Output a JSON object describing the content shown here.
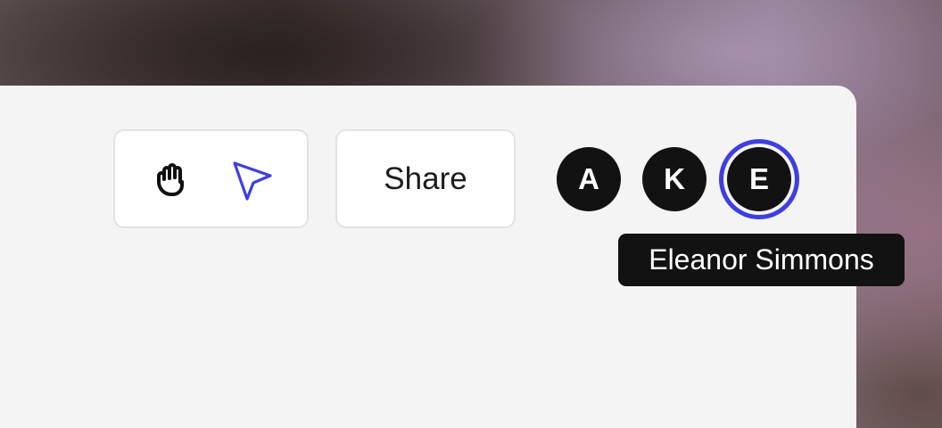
{
  "toolbar": {
    "tools": [
      {
        "icon": "hand-icon",
        "active": false
      },
      {
        "icon": "select-cursor-icon",
        "active": true
      }
    ],
    "share_label": "Share"
  },
  "collaborators": [
    {
      "initial": "A",
      "active": false
    },
    {
      "initial": "K",
      "active": false
    },
    {
      "initial": "E",
      "active": true
    }
  ],
  "tooltip": {
    "text": "Eleanor Simmons"
  },
  "colors": {
    "accent": "#3f3ee0",
    "avatar_bg": "#121212",
    "panel_bg": "#f4f4f4"
  }
}
